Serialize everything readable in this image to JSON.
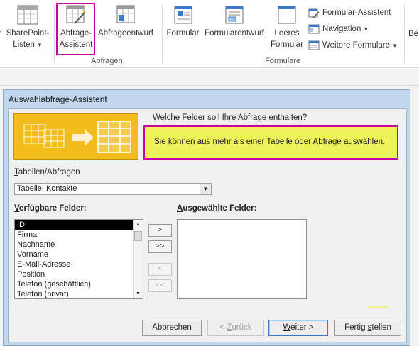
{
  "ribbon": {
    "sharepoint_line1": "SharePoint-",
    "sharepoint_line2": "Listen",
    "abfrage_assistent_line1": "Abfrage-",
    "abfrage_assistent_line2": "Assistent",
    "abfrageentwurf": "Abfrageentwurf",
    "group_abfragen": "Abfragen",
    "formular": "Formular",
    "formularentwurf": "Formularentwurf",
    "leeres_line1": "Leeres",
    "leeres_line2": "Formular",
    "formular_assistent": "Formular-Assistent",
    "navigation": "Navigation",
    "weitere_formulare": "Weitere Formulare",
    "group_formulare": "Formulare",
    "edge_left": "f",
    "edge_right": "Be"
  },
  "dialog": {
    "title": "Auswahlabfrage-Assistent",
    "question": "Welche Felder soll Ihre Abfrage enthalten?",
    "info": "Sie können aus mehr als einer Tabelle oder Abfrage auswählen.",
    "tables_label_first": "T",
    "tables_label_rest": "abellen/Abfragen",
    "combo_value": "Tabelle: Kontakte",
    "available_label_first": "V",
    "available_label_rest": "erfügbare Felder:",
    "selected_label_first": "A",
    "selected_label_rest": "usgewählte Felder:",
    "available_fields": [
      "ID",
      "Firma",
      "Nachname",
      "Vorname",
      "E-Mail-Adresse",
      "Position",
      "Telefon (geschäftlich)",
      "Telefon (privat)"
    ],
    "move_buttons": {
      "add_one": ">",
      "add_all": ">>",
      "remove_one": "<",
      "remove_all": "<<"
    },
    "buttons": {
      "cancel": "Abbrechen",
      "back_prefix": "< ",
      "back_first": "Z",
      "back_rest": "urück",
      "next_first": "W",
      "next_rest": "eiter >",
      "finish_pre": "Fertig ",
      "finish_first": "s",
      "finish_rest": "tellen"
    }
  },
  "colors": {
    "highlight": "#c800a0",
    "info_bg": "#eef25a",
    "wizard_image": "#f2bd1b",
    "dialog_frame": "#bfd6ec"
  }
}
